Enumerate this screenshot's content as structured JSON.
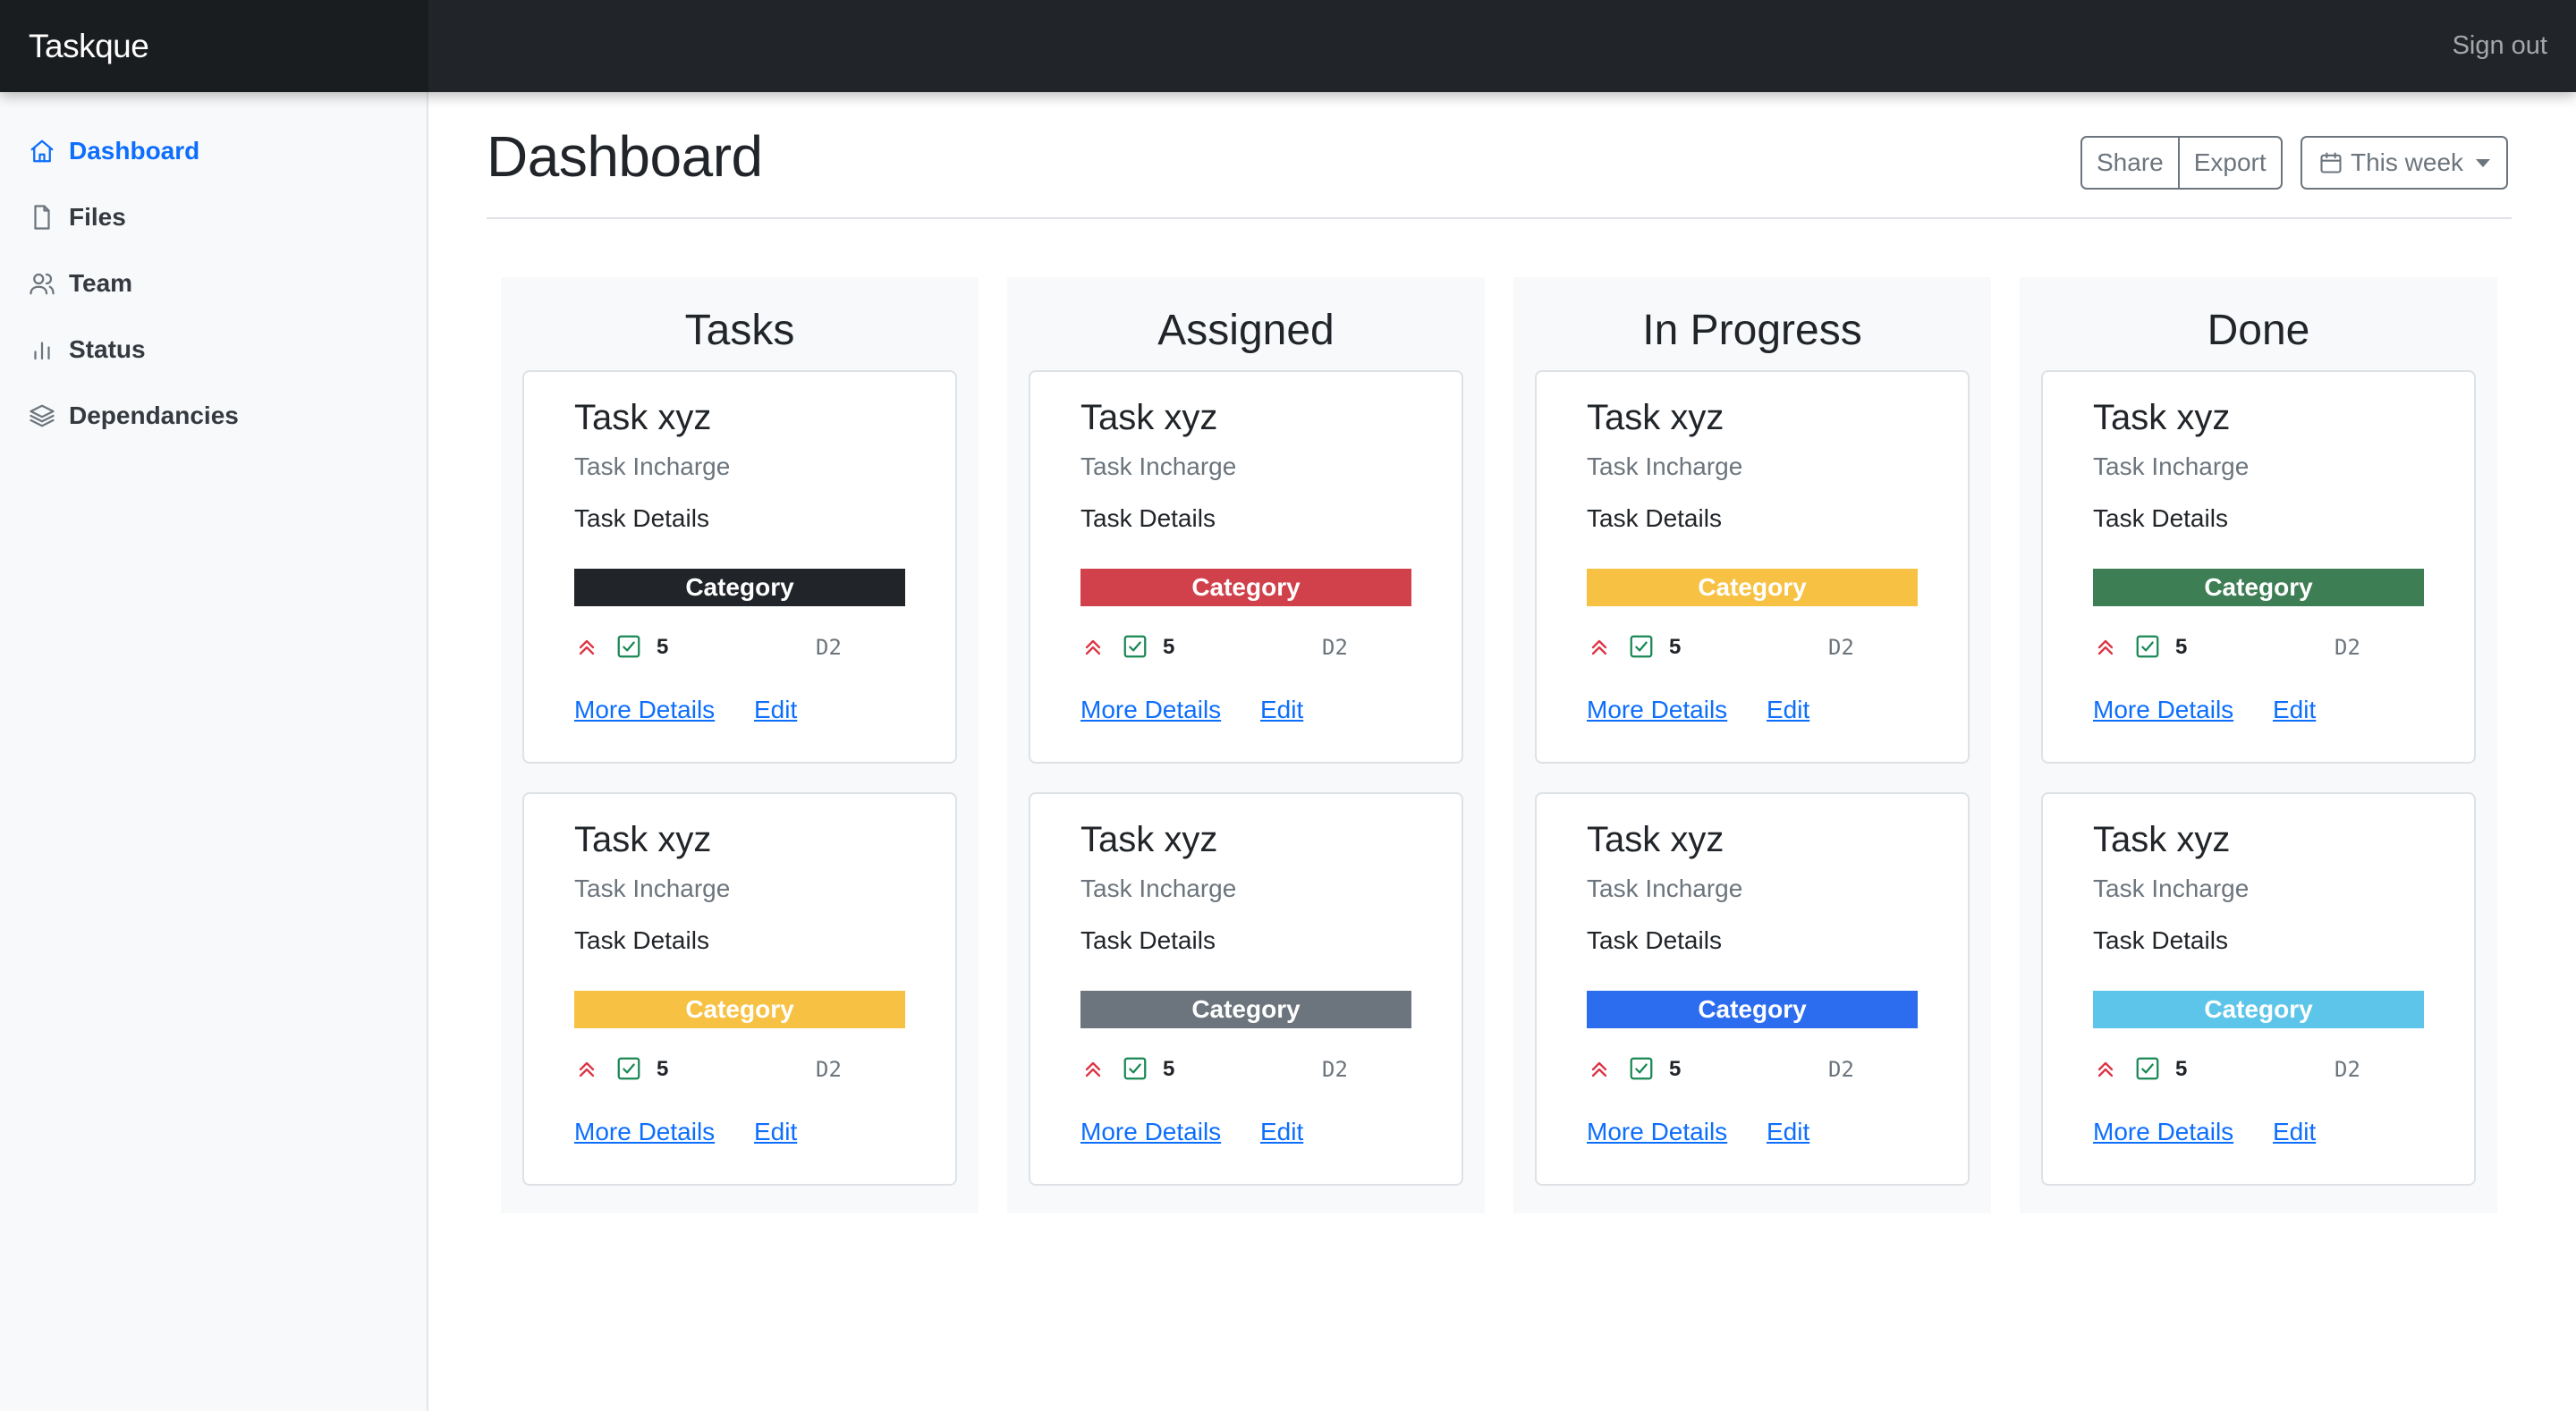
{
  "app": {
    "brand": "Taskque",
    "signout_label": "Sign out"
  },
  "sidebar": {
    "items": [
      {
        "label": "Dashboard",
        "icon": "home-icon",
        "active": true
      },
      {
        "label": "Files",
        "icon": "file-icon",
        "active": false
      },
      {
        "label": "Team",
        "icon": "users-icon",
        "active": false
      },
      {
        "label": "Status",
        "icon": "bar-chart-icon",
        "active": false
      },
      {
        "label": "Dependancies",
        "icon": "layers-icon",
        "active": false
      }
    ]
  },
  "header": {
    "title": "Dashboard",
    "share_label": "Share",
    "export_label": "Export",
    "range_label": "This week"
  },
  "colors": {
    "dark": "#212529",
    "danger": "#dc3545",
    "warning": "#ffc107",
    "success": "#198754",
    "secondary": "#6c757d",
    "primary": "#0d6efd",
    "info": "#0dcaf0",
    "link": "#0d6efd"
  },
  "columns": [
    {
      "title": "Tasks",
      "cards": [
        {
          "title": "Task xyz",
          "incharge": "Task Incharge",
          "details": "Task Details",
          "category": "Category",
          "category_color": "#212529",
          "priority_icon": "chevron-double-up-icon",
          "count": "5",
          "code": "D2",
          "more_label": "More Details",
          "edit_label": "Edit"
        },
        {
          "title": "Task xyz",
          "incharge": "Task Incharge",
          "details": "Task Details",
          "category": "Category",
          "category_color": "#f7c143",
          "priority_icon": "chevron-double-up-icon",
          "count": "5",
          "code": "D2",
          "more_label": "More Details",
          "edit_label": "Edit"
        }
      ]
    },
    {
      "title": "Assigned",
      "cards": [
        {
          "title": "Task xyz",
          "incharge": "Task Incharge",
          "details": "Task Details",
          "category": "Category",
          "category_color": "#d0414b",
          "priority_icon": "chevron-double-up-icon",
          "count": "5",
          "code": "D2",
          "more_label": "More Details",
          "edit_label": "Edit"
        },
        {
          "title": "Task xyz",
          "incharge": "Task Incharge",
          "details": "Task Details",
          "category": "Category",
          "category_color": "#6c757d",
          "priority_icon": "chevron-double-up-icon",
          "count": "5",
          "code": "D2",
          "more_label": "More Details",
          "edit_label": "Edit"
        }
      ]
    },
    {
      "title": "In Progress",
      "cards": [
        {
          "title": "Task xyz",
          "incharge": "Task Incharge",
          "details": "Task Details",
          "category": "Category",
          "category_color": "#f7c143",
          "priority_icon": "chevron-double-up-icon",
          "count": "5",
          "code": "D2",
          "more_label": "More Details",
          "edit_label": "Edit"
        },
        {
          "title": "Task xyz",
          "incharge": "Task Incharge",
          "details": "Task Details",
          "category": "Category",
          "category_color": "#2c6df0",
          "priority_icon": "chevron-double-up-icon",
          "count": "5",
          "code": "D2",
          "more_label": "More Details",
          "edit_label": "Edit"
        }
      ]
    },
    {
      "title": "Done",
      "cards": [
        {
          "title": "Task xyz",
          "incharge": "Task Incharge",
          "details": "Task Details",
          "category": "Category",
          "category_color": "#3e7e55",
          "priority_icon": "chevron-double-up-icon",
          "count": "5",
          "code": "D2",
          "more_label": "More Details",
          "edit_label": "Edit"
        },
        {
          "title": "Task xyz",
          "incharge": "Task Incharge",
          "details": "Task Details",
          "category": "Category",
          "category_color": "#5dc5ea",
          "priority_icon": "chevron-double-up-icon",
          "count": "5",
          "code": "D2",
          "more_label": "More Details",
          "edit_label": "Edit"
        }
      ]
    }
  ]
}
